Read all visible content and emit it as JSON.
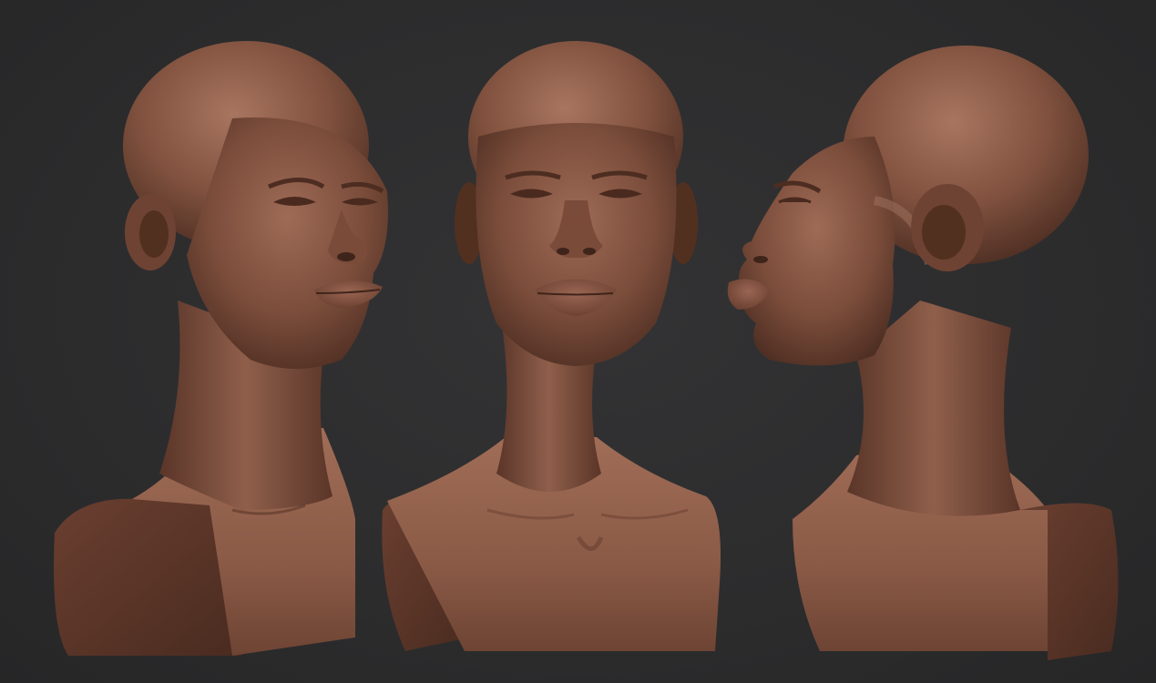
{
  "scene": {
    "background_color": "#2c2c2d",
    "material_color": "#8a5a45",
    "views": [
      {
        "name": "three-quarter-left"
      },
      {
        "name": "front"
      },
      {
        "name": "profile-left"
      }
    ]
  }
}
